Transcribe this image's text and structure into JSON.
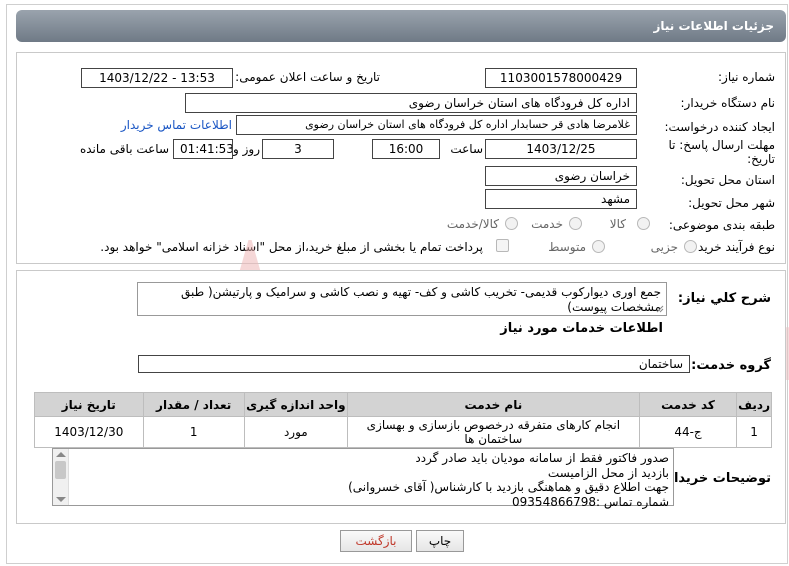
{
  "header": {
    "title": "جزئیات اطلاعات نیاز"
  },
  "info": {
    "need_number_label": "شماره نیاز:",
    "need_number": "1103001578000429",
    "announce_label": "تاریخ و ساعت اعلان عمومی:",
    "announce_value": "1403/12/22 - 13:53",
    "buyer_org_label": "نام دستگاه خریدار:",
    "buyer_org": "اداره کل فرودگاه های استان خراسان رضوی",
    "creator_label": "ایجاد کننده درخواست:",
    "creator": "غلامرضا هادی قر حسابدار اداره کل فرودگاه های استان خراسان رضوی",
    "contact_link": "اطلاعات تماس خریدار",
    "deadline_label_1": "مهلت ارسال پاسخ: تا",
    "deadline_label_2": "تاریخ:",
    "deadline_date": "1403/12/25",
    "time_label": "ساعت",
    "deadline_time": "16:00",
    "days_value": "3",
    "days_label": "روز و",
    "remaining_time": "01:41:53",
    "remaining_label": "ساعت باقی مانده",
    "province_label": "استان محل تحویل:",
    "province": "خراسان رضوی",
    "city_label": "شهر محل تحویل:",
    "city": "مشهد",
    "category_label": "طبقه بندی موضوعی:",
    "category_options": [
      "کالا",
      "خدمت",
      "کالا/خدمت"
    ],
    "process_label": "نوع فرآیند خرید :",
    "process_options": [
      "جزیی",
      "متوسط"
    ],
    "payment_note": "پرداخت تمام یا بخشی از مبلغ خرید،از محل \"اسناد خزانه اسلامی\" خواهد بود."
  },
  "need_desc": {
    "label": "شرح كلي نياز:",
    "text": "جمع اوری دیوارکوب قدیمی- تخریب کاشی و کف- تهیه و نصب کاشی و سرامیک و پارتیشن( طبق مشخصات پیوست)"
  },
  "services": {
    "section_title": "اطلاعات خدمات مورد نیاز",
    "group_label": "گروه خدمت:",
    "group_value": "ساختمان",
    "columns": [
      "ردیف",
      "کد خدمت",
      "نام خدمت",
      "واحد اندازه گیری",
      "تعداد / مقدار",
      "تاریخ نیاز"
    ],
    "rows": [
      [
        "1",
        "ج-44",
        "انجام کارهای متفرقه درخصوص بازسازی و بهسازی ساختمان ها",
        "مورد",
        "1",
        "1403/12/30"
      ]
    ]
  },
  "notes": {
    "label": "توضیحات خریدار:",
    "lines": [
      "صدور فاکتور فقط از سامانه مودیان باید صادر گردد",
      "بازدید از محل الزامیست",
      "جهت اطلاع دقیق و هماهنگی بازدید با کارشناس( آقای خسروانی)",
      "شماره تماس :09354866798"
    ]
  },
  "buttons": {
    "print": "چاپ",
    "back": "بازگشت"
  },
  "watermark": {
    "text": "AriaTender.neT"
  },
  "colors": {
    "link": "#1a56c4",
    "back_button_text": "#c0392b",
    "watermark": "#e9a9a9"
  }
}
